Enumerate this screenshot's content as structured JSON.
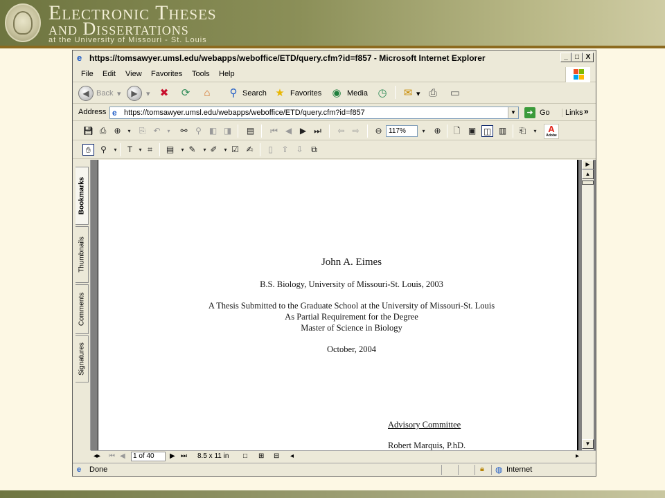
{
  "banner": {
    "line1": "Electronic Theses",
    "line2": "and Dissertations",
    "line3": "at the University of Missouri - St. Louis"
  },
  "window": {
    "title": "https://tomsawyer.umsl.edu/webapps/weboffice/ETD/query.cfm?id=f857 - Microsoft Internet Explorer",
    "controls": {
      "minimize": "_",
      "maximize": "□",
      "close": "X"
    }
  },
  "menu": [
    "File",
    "Edit",
    "View",
    "Favorites",
    "Tools",
    "Help"
  ],
  "toolbar": {
    "back_label": "Back",
    "search_label": "Search",
    "favorites_label": "Favorites",
    "media_label": "Media"
  },
  "address": {
    "label": "Address",
    "url": "https://tomsawyer.umsl.edu/webapps/weboffice/ETD/query.cfm?id=f857",
    "go_label": "Go",
    "links_label": "Links",
    "links_chevron": "»"
  },
  "acrobat": {
    "zoom": "117%"
  },
  "side_tabs": [
    "Bookmarks",
    "Thumbnails",
    "Comments",
    "Signatures"
  ],
  "document": {
    "name": "John A. Eimes",
    "degree": "B.S. Biology, University of Missouri-St. Louis, 2003",
    "thesis_line1": "A Thesis Submitted to the Graduate School at the University of Missouri-St. Louis",
    "thesis_line2": "As Partial Requirement for the Degree",
    "thesis_line3": "Master of Science in Biology",
    "date": "October, 2004",
    "committee_heading": "Advisory Committee",
    "committee_member": "Robert Marquis, P.hD."
  },
  "pdf_status": {
    "page_info": "1 of 40",
    "page_size": "8.5 x 11 in"
  },
  "ie_status": {
    "done": "Done",
    "zone": "Internet"
  },
  "colors": {
    "banner_start": "#6E7540",
    "banner_end": "#CFCCA4",
    "slide_bg": "#FDF8E4",
    "window_chrome": "#ECE9D8",
    "doc_bg": "#808080"
  }
}
